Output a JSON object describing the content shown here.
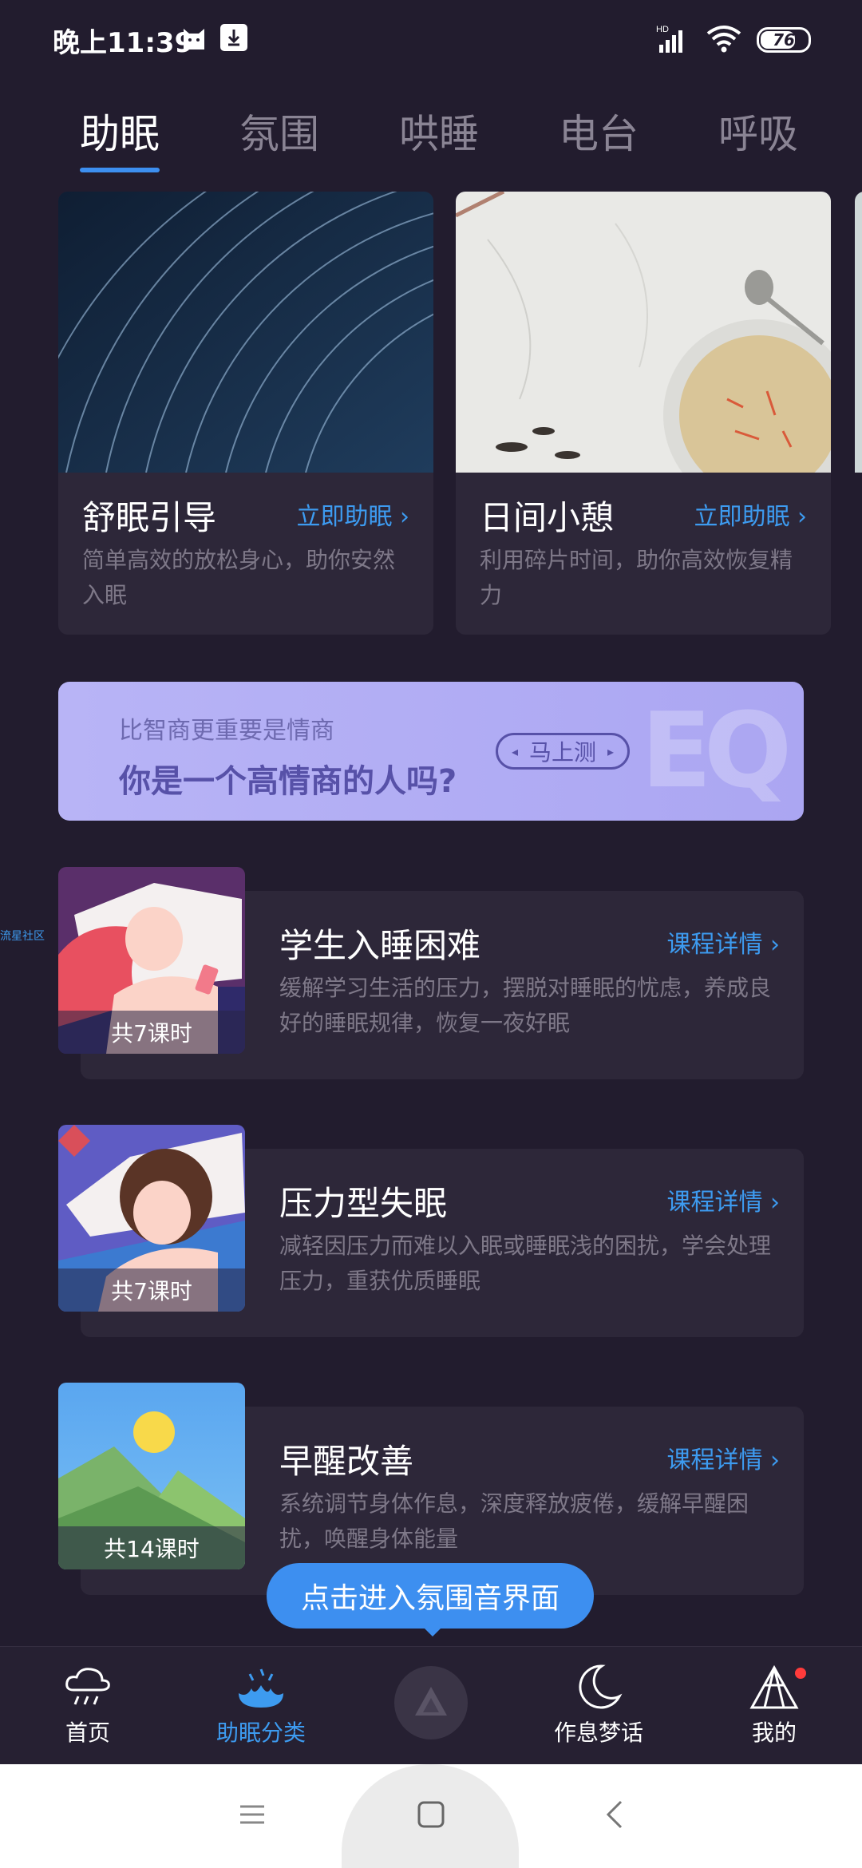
{
  "status_bar": {
    "time": "晚上11:39",
    "network": "HD",
    "battery": "76",
    "battery_level": 0.76
  },
  "tabs": [
    {
      "label": "助眠",
      "active": true
    },
    {
      "label": "氛围",
      "active": false
    },
    {
      "label": "哄睡",
      "active": false
    },
    {
      "label": "电台",
      "active": false
    },
    {
      "label": "呼吸",
      "active": false
    }
  ],
  "top_cards": [
    {
      "title": "舒眠引导",
      "link": "立即助眠",
      "desc": "简单高效的放松身心，助你安然入眠"
    },
    {
      "title": "日间小憩",
      "link": "立即助眠",
      "desc": "利用碎片时间，助你高效恢复精力"
    }
  ],
  "banner": {
    "subtitle": "比智商更重要是情商",
    "title": "你是一个高情商的人吗?",
    "button": "马上测",
    "logo_text": "EQ"
  },
  "side_note": "流星社区",
  "courses": [
    {
      "title": "学生入睡困难",
      "link": "课程详情",
      "desc": "缓解学习生活的压力，摆脱对睡眠的忧虑，养成良好的睡眠规律，恢复一夜好眠",
      "count": "共7课时"
    },
    {
      "title": "压力型失眠",
      "link": "课程详情",
      "desc": "减轻因压力而难以入眠或睡眠浅的困扰，学会处理压力，重获优质睡眠",
      "count": "共7课时"
    },
    {
      "title": "早醒改善",
      "link": "课程详情",
      "desc": "系统调节身体作息，深度释放疲倦，缓解早醒困扰，唤醒身体能量",
      "count": "共14课时"
    }
  ],
  "tooltip": "点击进入氛围音界面",
  "bottom_nav": [
    {
      "label": "首页",
      "icon": "cloud-rain-icon",
      "active": false
    },
    {
      "label": "助眠分类",
      "icon": "lotus-icon",
      "active": true
    },
    {
      "label": "",
      "icon": "triangle-play-icon",
      "active": false
    },
    {
      "label": "作息梦话",
      "icon": "moon-icon",
      "active": false
    },
    {
      "label": "我的",
      "icon": "tent-icon",
      "active": false
    }
  ],
  "colors": {
    "accent": "#3d8ff0",
    "background": "#221c2e",
    "card": "#2d2739",
    "banner": "#b8b4f6",
    "badge": "#ff3b3b"
  }
}
